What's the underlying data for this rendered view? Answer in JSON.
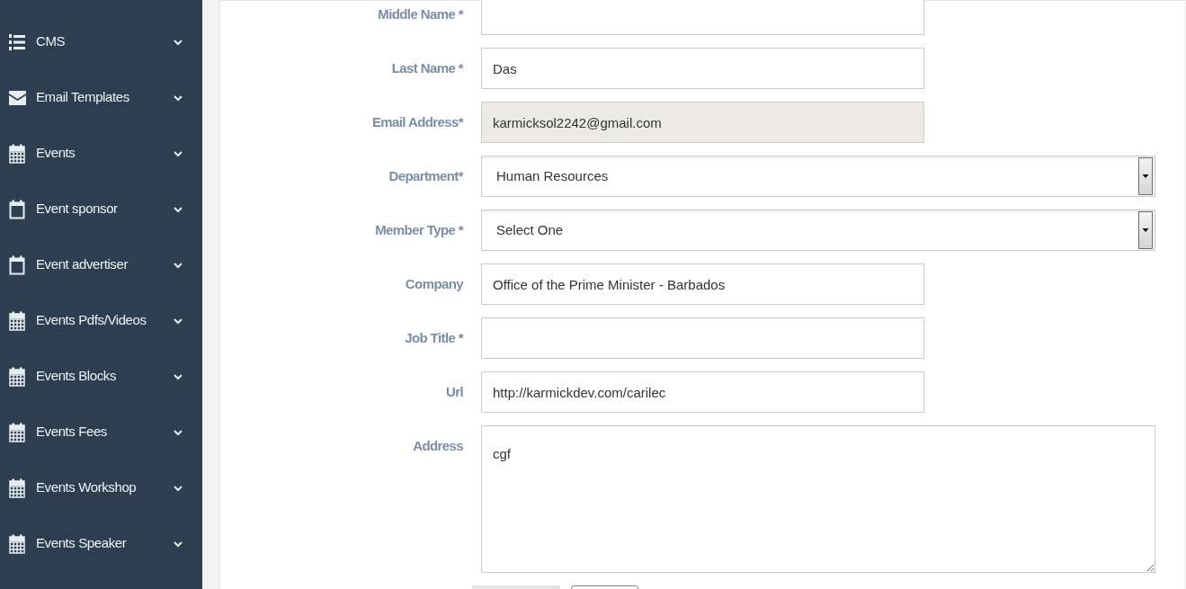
{
  "sidebar": {
    "items": [
      {
        "label": "CMS"
      },
      {
        "label": "Email Templates"
      },
      {
        "label": "Events"
      },
      {
        "label": "Event sponsor"
      },
      {
        "label": "Event advertiser"
      },
      {
        "label": "Events Pdfs/Videos"
      },
      {
        "label": "Events Blocks"
      },
      {
        "label": "Events Fees"
      },
      {
        "label": "Events Workshop"
      },
      {
        "label": "Events Speaker"
      }
    ]
  },
  "form": {
    "fields": [
      {
        "label": "Middle Name *",
        "kind": "text",
        "disabled": false
      },
      {
        "label": "Last Name *",
        "kind": "text",
        "value": "Das",
        "disabled": false
      },
      {
        "label": "Email Address*",
        "kind": "text",
        "value": "karmicksol2242@gmail.com",
        "disabled": true
      },
      {
        "label": "Department*",
        "kind": "select",
        "value": "Human Resources",
        "disabled": false
      },
      {
        "label": "Member Type *",
        "kind": "select",
        "value": "Select One",
        "disabled": false
      },
      {
        "label": "Company",
        "kind": "text",
        "value": "Office of the Prime Minister - Barbados",
        "disabled": false
      },
      {
        "label": "Job Title *",
        "kind": "text",
        "disabled": false
      },
      {
        "label": "Url",
        "kind": "text",
        "value": "http://karmickdev.com/carilec",
        "disabled": false
      },
      {
        "label": "Address",
        "kind": "textarea",
        "value": "cgf",
        "disabled": false
      }
    ]
  }
}
